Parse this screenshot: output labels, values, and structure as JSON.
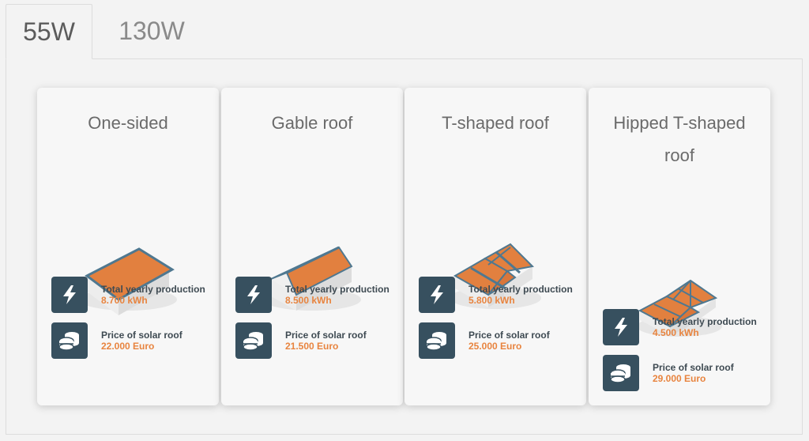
{
  "tabs": [
    {
      "label": "55W",
      "active": true
    },
    {
      "label": "130W",
      "active": false
    }
  ],
  "cards": [
    {
      "title": "One-sided",
      "production_label": "Total yearly production",
      "production_value": "8.700 kWh",
      "price_label": "Price of solar roof",
      "price_value": "22.000 Euro"
    },
    {
      "title": "Gable roof",
      "production_label": "Total yearly production",
      "production_value": "8.500 kWh",
      "price_label": "Price of solar roof",
      "price_value": "21.500 Euro"
    },
    {
      "title": "T-shaped roof",
      "production_label": "Total yearly production",
      "production_value": "5.800 kWh",
      "price_label": "Price of solar roof",
      "price_value": "25.000 Euro"
    },
    {
      "title": "Hipped T-shaped roof",
      "production_label": "Total yearly production",
      "production_value": "4.500 kWh",
      "price_label": "Price of solar roof",
      "price_value": "29.000 Euro"
    }
  ],
  "icons": {
    "production": "lightning-bolt-icon",
    "price": "coin-stack-icon"
  },
  "colors": {
    "accent": "#e8843f",
    "icon_bg": "#37505f",
    "roof": "#e2803f",
    "roof_edge": "#4f7890"
  }
}
